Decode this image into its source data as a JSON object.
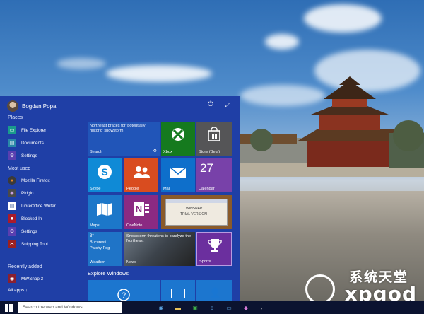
{
  "user": {
    "name": "Bogdan Popa"
  },
  "places": {
    "heading": "Places",
    "items": [
      {
        "label": "File Explorer",
        "icon": "folder-icon",
        "color": "#1a9b8c"
      },
      {
        "label": "Documents",
        "icon": "documents-icon",
        "color": "#2a88a8"
      },
      {
        "label": "Settings",
        "icon": "gear-icon",
        "color": "#5a3fb0"
      }
    ]
  },
  "most_used": {
    "heading": "Most used",
    "items": [
      {
        "label": "Mozilla Firefox",
        "icon": "firefox-icon",
        "color": "#3a3a3a"
      },
      {
        "label": "Pidgin",
        "icon": "pidgin-icon",
        "color": "#4a4a4a"
      },
      {
        "label": "LibreOffice Writer",
        "icon": "writer-icon",
        "color": "#3a5a9a"
      },
      {
        "label": "Blocked In",
        "icon": "blocked-in-icon",
        "color": "#aa1b2b"
      },
      {
        "label": "Settings",
        "icon": "gear-icon",
        "color": "#5a3fb0"
      },
      {
        "label": "Snipping Tool",
        "icon": "scissors-icon",
        "color": "#9b2020"
      }
    ]
  },
  "recently_added": {
    "heading": "Recently added",
    "items": [
      {
        "label": "MWSnap 3",
        "icon": "mwsnap-icon",
        "color": "#8a2030"
      }
    ]
  },
  "all_apps": "All apps ↓",
  "tiles": {
    "search": {
      "headline": "Northeast braces for 'potentially historic' snowstorm",
      "label": "Search"
    },
    "xbox": {
      "label": "Xbox"
    },
    "store": {
      "label": "Store (Beta)"
    },
    "skype": {
      "label": "Skype"
    },
    "people": {
      "label": "People"
    },
    "mail": {
      "label": "Mail"
    },
    "calendar": {
      "label": "Calendar",
      "date": "27"
    },
    "maps": {
      "label": "Maps"
    },
    "onenote": {
      "label": "OneNote"
    },
    "desktop": {
      "title": "WINSNAP",
      "subtitle": "TRIAL VERSION"
    },
    "weather": {
      "temp": "3°",
      "city": "Bucuresti",
      "cond": "Patchy Fog",
      "label": "Weather"
    },
    "news": {
      "headline": "Snowstorm threatens to paralyze the Northeast",
      "label": "News"
    },
    "sports": {
      "label": "Sports"
    }
  },
  "explore": {
    "heading": "Explore Windows"
  },
  "taskbar": {
    "search_placeholder": "Search the web and Windows"
  },
  "watermark": {
    "cn": "系统天堂",
    "en": "xpgod"
  },
  "colors": {
    "start_bg": "#1f3fa6",
    "taskbar_bg": "#0b1330"
  }
}
